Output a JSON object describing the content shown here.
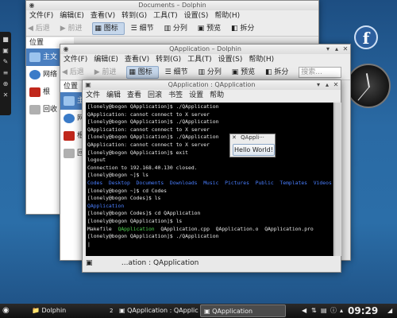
{
  "window_back": {
    "title": "Documents – Dolphin",
    "menu": [
      "文件(F)",
      "编辑(E)",
      "查看(V)",
      "转到(G)",
      "工具(T)",
      "设置(S)",
      "帮助(H)"
    ],
    "toolbar": {
      "back": "后退",
      "forward": "前进",
      "icons": "图标",
      "details": "细节",
      "split": "分列",
      "preview": "预览",
      "split2": "拆分"
    },
    "places_header": "位置",
    "places": [
      "主文",
      "网络",
      "根",
      "回收"
    ]
  },
  "window_mid": {
    "title": "QApplication – Dolphin",
    "menu": [
      "文件(F)",
      "编辑(E)",
      "查看(V)",
      "转到(G)",
      "工具(T)",
      "设置(S)",
      "帮助(H)"
    ],
    "toolbar": {
      "back": "后退",
      "forward": "前进",
      "icons": "图标",
      "details": "细节",
      "split": "分列",
      "preview": "预览",
      "split2": "拆分",
      "search": "搜索..."
    },
    "places_header": "位置",
    "places": [
      "主",
      "网",
      "根",
      "回"
    ]
  },
  "terminal": {
    "title": "QApplication : QApplication",
    "menu": [
      "文件",
      "编辑",
      "查看",
      "回滚",
      "书签",
      "设置",
      "帮助"
    ],
    "lines": [
      {
        "t": "[lonely@bogon QApplication]$ ./QApplication",
        "c": ""
      },
      {
        "t": "QApplication: cannot connect to X server",
        "c": ""
      },
      {
        "t": "[lonely@bogon QApplication]$ ./QApplication",
        "c": ""
      },
      {
        "t": "QApplication: cannot connect to X server",
        "c": ""
      },
      {
        "t": "[lonely@bogon QApplication]$ ./QApplication",
        "c": ""
      },
      {
        "t": "QApplication: cannot connect to X server",
        "c": ""
      },
      {
        "t": "[lonely@bogon QApplication]$ exit",
        "c": ""
      },
      {
        "t": "logout",
        "c": ""
      },
      {
        "t": "Connection to 192.168.40.130 closed.",
        "c": ""
      },
      {
        "t": "[lonely@bogon ~]$ ls",
        "c": ""
      },
      {
        "t": "Codes  Desktop  Documents  Downloads  Music  Pictures  Public  Templates  Videos",
        "c": "blue"
      },
      {
        "t": "[lonely@bogon ~]$ cd Codes",
        "c": ""
      },
      {
        "t": "[lonely@bogon Codes]$ ls",
        "c": ""
      },
      {
        "t": "QApplication",
        "c": "blue"
      },
      {
        "t": "[lonely@bogon Codes]$ cd QApplication",
        "c": ""
      },
      {
        "t": "[lonely@bogon QApplication]$ ls",
        "c": ""
      },
      {
        "t": "Makefile  QApplication  QApplication.cpp  QApplication.o  QApplication.pro",
        "c": "mixed"
      },
      {
        "t": "[lonely@bogon QApplication]$ ./QApplication",
        "c": ""
      },
      {
        "t": "|",
        "c": ""
      }
    ],
    "tab_label": "...ation : QApplication"
  },
  "popup": {
    "title": "QAppli···",
    "button": "Hello World!"
  },
  "taskbar": {
    "tasks": [
      "Dolphin",
      "QApplication : QApplication",
      "QApplication"
    ],
    "task_count": "2",
    "clock": "09:29"
  },
  "desktop": {
    "logo": "f"
  }
}
